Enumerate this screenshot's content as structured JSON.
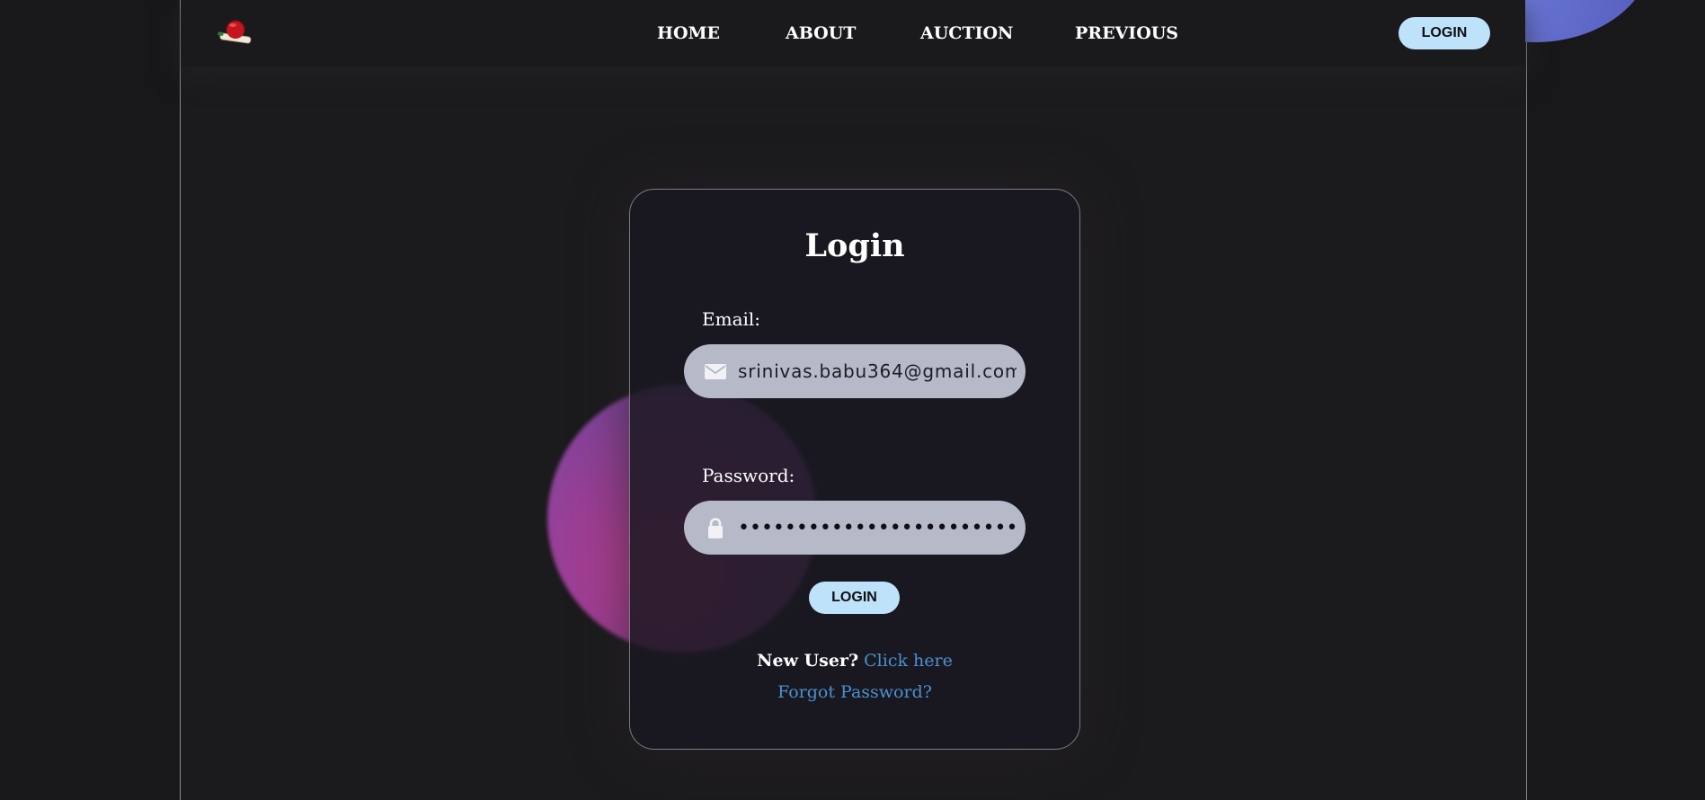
{
  "nav": {
    "logo_icon": "cricket-ball-bat-icon",
    "links": [
      "HOME",
      "ABOUT",
      "AUCTION",
      "PREVIOUS"
    ],
    "login_label": "LOGIN"
  },
  "login_card": {
    "title": "Login",
    "email": {
      "label": "Email:",
      "value": "srinivas.babu364@gmail.com",
      "icon": "envelope-icon"
    },
    "password": {
      "label": "Password:",
      "value": "••••••••••••••••••••••••••",
      "icon": "lock-icon"
    },
    "submit_label": "LOGIN",
    "new_user_text": "New User?",
    "new_user_link": "Click here",
    "forgot_link": "Forgot Password?"
  },
  "colors": {
    "background": "#18181a",
    "button_bg": "#bde2fa",
    "link": "#4b91cf",
    "input_bg": "#b6bac8",
    "accent_blob_pink": "#c03c8e",
    "accent_blob_blue": "#6b78d6"
  }
}
